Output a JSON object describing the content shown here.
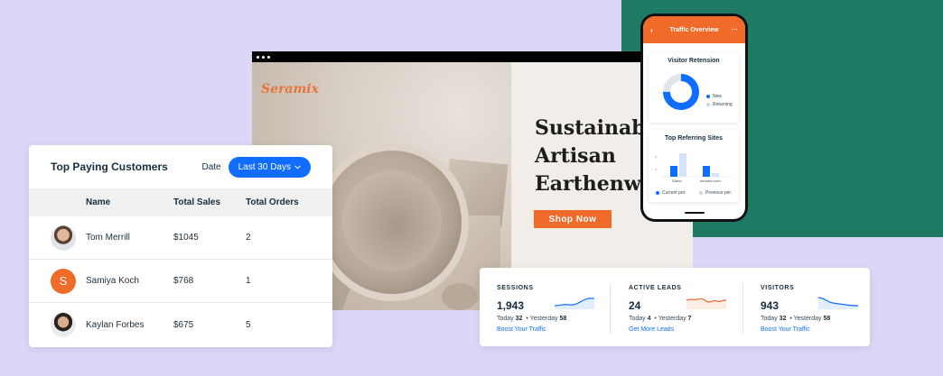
{
  "colors": {
    "background": "#dcd6f7",
    "green_panel": "#1e7a62",
    "accent_orange": "#f06a2a",
    "primary_blue": "#116dff"
  },
  "website": {
    "brand": "Seramix",
    "headline_lines": [
      "Sustainable",
      "Artisan",
      "Earthenwa"
    ],
    "shop_button": "Shop Now"
  },
  "customers": {
    "title": "Top Paying Customers",
    "date_label": "Date",
    "date_filter": "Last 30 Days",
    "columns": [
      "Name",
      "Total Sales",
      "Total Orders"
    ],
    "rows": [
      {
        "name": "Tom Merrill",
        "sales": "$1045",
        "orders": "2",
        "avatar": "photo"
      },
      {
        "name": "Samiya Koch",
        "sales": "$768",
        "orders": "1",
        "avatar": "S"
      },
      {
        "name": "Kaylan Forbes",
        "sales": "$675",
        "orders": "5",
        "avatar": "photo"
      }
    ]
  },
  "phone": {
    "title": "Traffic Overview",
    "retention": {
      "title": "Visitor Retension",
      "legend": [
        "New",
        "Returning"
      ],
      "new_fraction": 0.75
    },
    "referring": {
      "title": "Top Referring Sites",
      "sites": [
        "Direct",
        "seramix.com"
      ],
      "legend": [
        "Current per.",
        "Previous per."
      ],
      "y_ticks": [
        "2",
        "1"
      ]
    }
  },
  "stats": [
    {
      "label": "SESSIONS",
      "value": "1,943",
      "today_label": "Today",
      "today": "32",
      "yesterday_label": "Yesterday",
      "yesterday": "58",
      "link": "Boost Your Traffic",
      "color": "#116dff"
    },
    {
      "label": "ACTIVE LEADS",
      "value": "24",
      "today_label": "Today",
      "today": "4",
      "yesterday_label": "Yesterday",
      "yesterday": "7",
      "link": "Get More Leads",
      "color": "#f06a2a"
    },
    {
      "label": "VISITORS",
      "value": "943",
      "today_label": "Today",
      "today": "32",
      "yesterday_label": "Yesterday",
      "yesterday": "58",
      "link": "Boost Your Traffic",
      "color": "#116dff"
    }
  ]
}
